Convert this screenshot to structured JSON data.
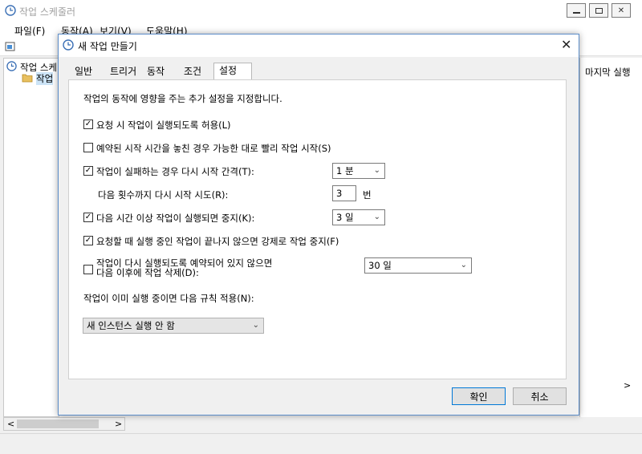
{
  "main_window": {
    "title": "작업 스케줄러",
    "menu": [
      "파일(F)",
      "동작(A)",
      "보기(V)",
      "도움말(H)"
    ],
    "tree_items": [
      "작업 스케",
      "작업"
    ],
    "right_column_header": "마지막 실행",
    "scroll_left": "<",
    "scroll_right": ">",
    "scroll_right_vertical": ">"
  },
  "dialog": {
    "title": "새 작업 만들기",
    "close": "✕",
    "tabs": [
      "일반",
      "트리거",
      "동작",
      "조건",
      "설정"
    ],
    "active_tab": "설정",
    "description": "작업의 동작에 영향을 주는 추가 설정을 지정합니다.",
    "options": {
      "allow_on_demand": {
        "label": "요청 시 작업이 실행되도록 허용(L)",
        "checked": "✓"
      },
      "run_asap_missed": {
        "label": "예약된 시작 시간을 놓친 경우 가능한 대로 빨리 작업 시작(S)",
        "checked": ""
      },
      "restart_on_fail": {
        "label": "작업이 실패하는 경우 다시 시작 간격(T):",
        "checked": "✓",
        "value": "1 분"
      },
      "restart_attempts": {
        "label": "다음 횟수까지 다시 시작 시도(R):",
        "value": "3",
        "unit": "번"
      },
      "stop_if_longer": {
        "label": "다음 시간 이상 작업이 실행되면 중지(K):",
        "checked": "✓",
        "value": "3 일"
      },
      "force_stop": {
        "label": "요청할 때 실행 중인 작업이 끝나지 않으면 강제로 작업 중지(F)",
        "checked": "✓"
      },
      "delete_if_not_scheduled": {
        "label_line1": "작업이 다시 실행되도록 예약되어 있지 않으면",
        "label_line2": "다음 이후에 작업 삭제(D):",
        "checked": "",
        "value": "30 일"
      }
    },
    "rule_label": "작업이 이미 실행 중이면 다음 규칙 적용(N):",
    "rule_value": "새 인스턴스 실행 안 함",
    "ok_label": "확인",
    "cancel_label": "취소"
  },
  "icons": {
    "dropdown": "⌄",
    "chevron": "∨"
  }
}
